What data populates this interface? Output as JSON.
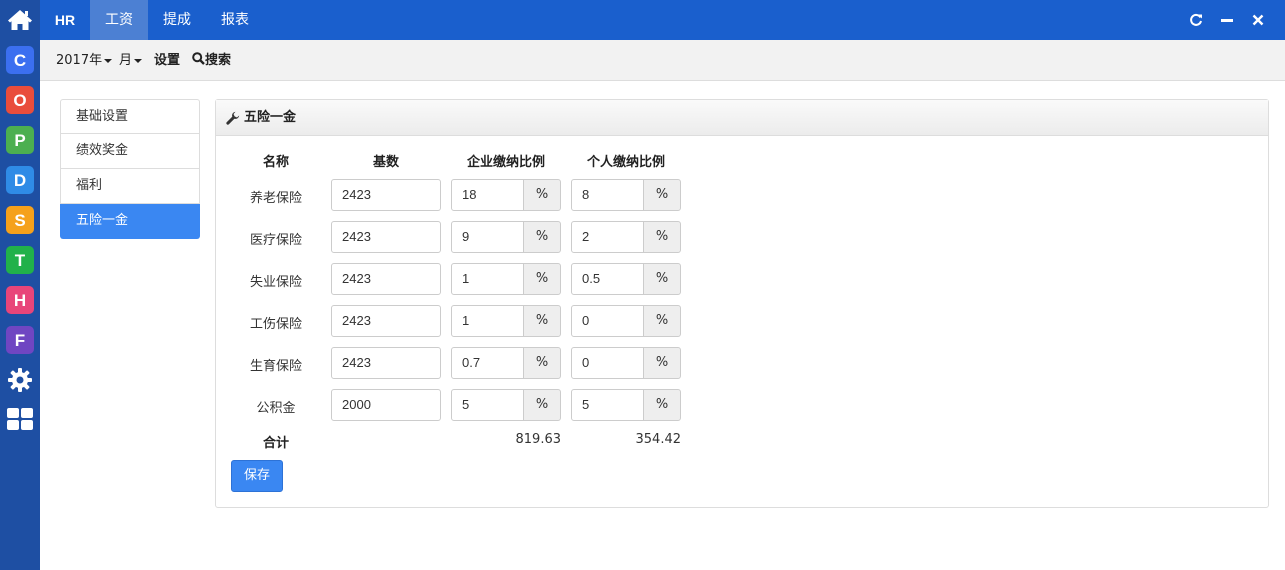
{
  "topbar": {
    "brand": "HR",
    "tabs": [
      {
        "label": "工资",
        "active": true
      },
      {
        "label": "提成",
        "active": false
      },
      {
        "label": "报表",
        "active": false
      }
    ]
  },
  "rail": {
    "apps": [
      {
        "letter": "C",
        "color": "#3b6ff0"
      },
      {
        "letter": "O",
        "color": "#e94d3c"
      },
      {
        "letter": "P",
        "color": "#4caf50"
      },
      {
        "letter": "D",
        "color": "#2f8be6"
      },
      {
        "letter": "S",
        "color": "#f5a11c"
      },
      {
        "letter": "T",
        "color": "#21b14a"
      },
      {
        "letter": "H",
        "color": "#e8457a"
      },
      {
        "letter": "F",
        "color": "#6f46c2"
      }
    ]
  },
  "subbar": {
    "year": "2017年",
    "month": "月",
    "settings": "设置",
    "search": "搜索"
  },
  "sidemenu": {
    "items": [
      {
        "label": "基础设置",
        "active": false
      },
      {
        "label": "绩效奖金",
        "active": false
      },
      {
        "label": "福利",
        "active": false
      },
      {
        "label": "五险一金",
        "active": true
      }
    ]
  },
  "panel": {
    "title": "五险一金",
    "headers": {
      "name": "名称",
      "base": "基数",
      "company": "企业缴纳比例",
      "personal": "个人缴纳比例"
    },
    "percent": "%",
    "rows": [
      {
        "name": "养老保险",
        "base": "2423",
        "company": "18",
        "personal": "8"
      },
      {
        "name": "医疗保险",
        "base": "2423",
        "company": "9",
        "personal": "2"
      },
      {
        "name": "失业保险",
        "base": "2423",
        "company": "1",
        "personal": "0.5"
      },
      {
        "name": "工伤保险",
        "base": "2423",
        "company": "1",
        "personal": "0"
      },
      {
        "name": "生育保险",
        "base": "2423",
        "company": "0.7",
        "personal": "0"
      },
      {
        "name": "公积金",
        "base": "2000",
        "company": "5",
        "personal": "5"
      }
    ],
    "total_label": "合计",
    "total_company": "819.63",
    "total_personal": "354.42",
    "save_label": "保存"
  },
  "colors": {
    "topbar": "#1a5fcd",
    "rail": "#1e4fa3",
    "accent": "#3a87f2"
  }
}
